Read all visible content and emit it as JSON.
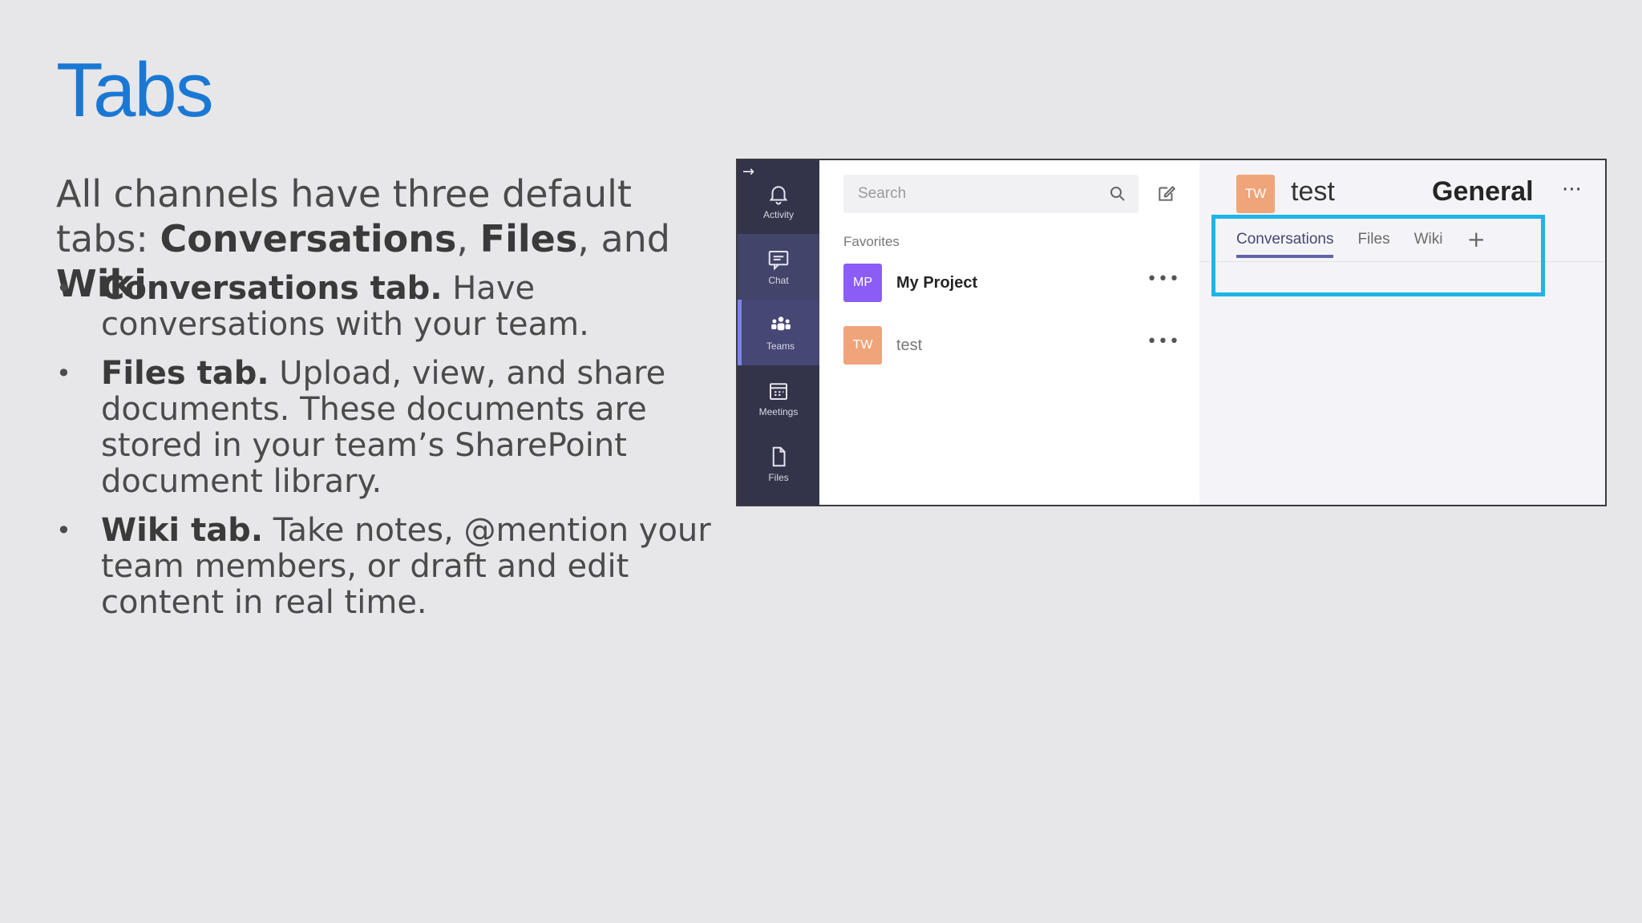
{
  "slide": {
    "title": "Tabs",
    "intro_plain": "All channels have three default tabs: ",
    "intro_b1": "Conversations",
    "intro_sep1": ", ",
    "intro_b2": "Files",
    "intro_sep2": ", and ",
    "intro_b3": "Wiki",
    "intro_end": "."
  },
  "bullets": [
    {
      "head": "Conversations tab.",
      "body": " Have conversations with your team."
    },
    {
      "head": "Files tab.",
      "body": " Upload, view, and share documents. These documents are stored in your team’s SharePoint document library."
    },
    {
      "head": "Wiki tab.",
      "body": " Take notes, @mention your team members, or draft and edit content in real time."
    }
  ],
  "bullet_char": "•",
  "teams": {
    "rail": [
      {
        "label": "Activity",
        "icon": "bell-icon"
      },
      {
        "label": "Chat",
        "icon": "chat-icon"
      },
      {
        "label": "Teams",
        "icon": "teams-icon"
      },
      {
        "label": "Meetings",
        "icon": "calendar-icon"
      },
      {
        "label": "Files",
        "icon": "file-icon"
      }
    ],
    "search_placeholder": "Search",
    "favorites_label": "Favorites",
    "list": [
      {
        "initials": "MP",
        "name": "My Project",
        "color": "#8b5cf6"
      },
      {
        "initials": "TW",
        "name": "test",
        "color": "#f0a47a"
      }
    ],
    "more": "•••",
    "header": {
      "initials": "TW",
      "team": "test",
      "channel": "General",
      "more": "···"
    },
    "tabs": [
      "Conversations",
      "Files",
      "Wiki"
    ],
    "tab_add": "+",
    "colors": {
      "rail": "#33344a",
      "accent": "#6264a7",
      "highlight": "#1fb4e6"
    }
  }
}
